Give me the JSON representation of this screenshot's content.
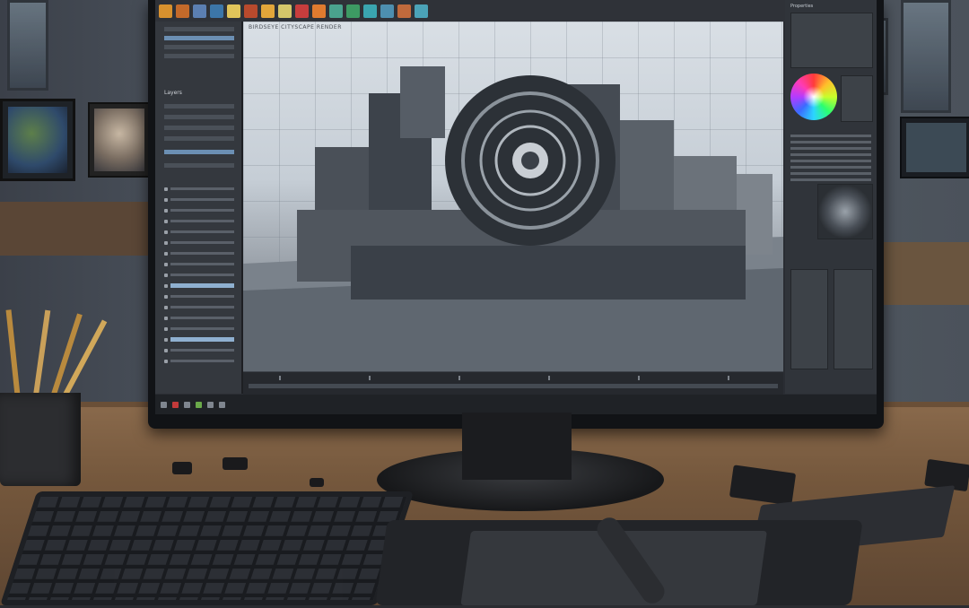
{
  "scene": {
    "description_free": true
  },
  "app": {
    "viewport_title": "BIRDSEYE CITYSCAPE RENDER",
    "right_panel_title": "Properties",
    "left_panel_title": "Layers"
  },
  "toolbar": {
    "icons": [
      {
        "name": "brush-icon",
        "color": "#d8912e"
      },
      {
        "name": "layer-icon",
        "color": "#c46a2a"
      },
      {
        "name": "select-icon",
        "color": "#5b7fb2"
      },
      {
        "name": "mesh-icon",
        "color": "#3c76a8"
      },
      {
        "name": "sculpt-icon",
        "color": "#e0c45a"
      },
      {
        "name": "paint-icon",
        "color": "#b84a2d"
      },
      {
        "name": "light-icon",
        "color": "#e2a63a"
      },
      {
        "name": "camera-icon",
        "color": "#d4c66a"
      },
      {
        "name": "render-icon",
        "color": "#c73d3d"
      },
      {
        "name": "material-icon",
        "color": "#e07b2f"
      },
      {
        "name": "texture-icon",
        "color": "#4aa38e"
      },
      {
        "name": "node-icon",
        "color": "#3d9a63"
      },
      {
        "name": "effects-icon",
        "color": "#3aa5b0"
      },
      {
        "name": "rig-icon",
        "color": "#4d8fb0"
      },
      {
        "name": "animate-icon",
        "color": "#c06a3c"
      },
      {
        "name": "export-icon",
        "color": "#4ba3b8"
      }
    ]
  },
  "colors": {
    "accent": "#6b8fb3",
    "ui_dark": "#2a2d33",
    "desk": "#74573c"
  }
}
